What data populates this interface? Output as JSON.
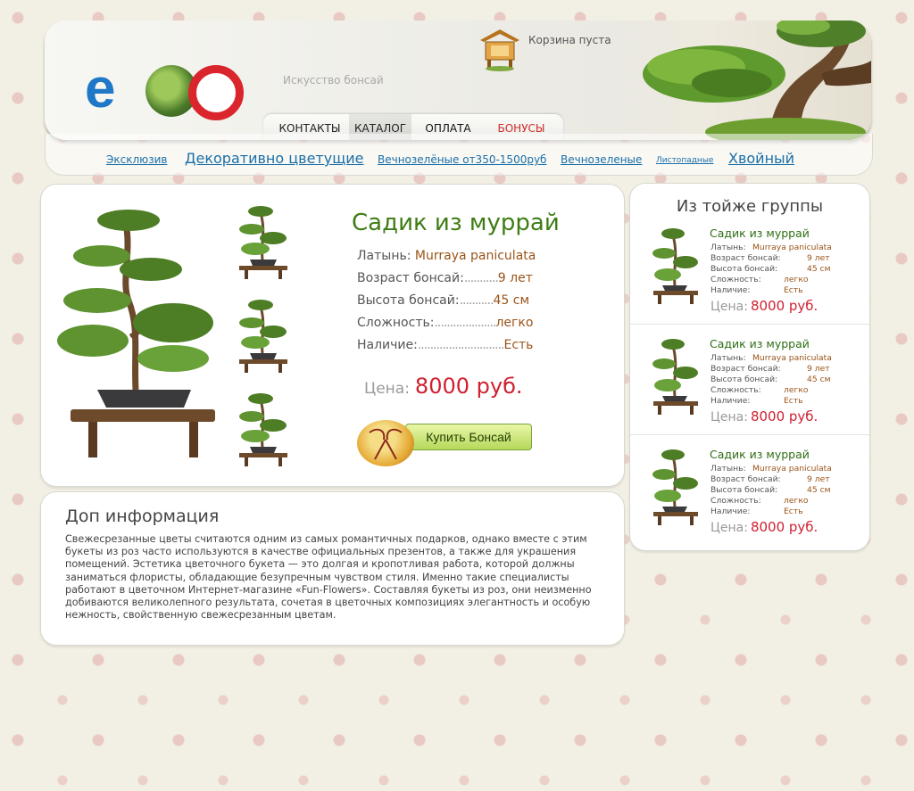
{
  "header": {
    "tagline": "Искусство бонсай",
    "cart_text": "Корзина пуста",
    "nav": [
      {
        "label": "КОНТАКТЫ"
      },
      {
        "label": "КАТАЛОГ"
      },
      {
        "label": "ОПЛАТА"
      },
      {
        "label": "БОНУСЫ"
      }
    ]
  },
  "subnav": [
    {
      "label": "Эксклюзив"
    },
    {
      "label": "Декоративно цветущие"
    },
    {
      "label": "Вечнозелёные от350-1500руб"
    },
    {
      "label": "Вечнозеленые"
    },
    {
      "label": "Листопадные"
    },
    {
      "label": "Хвойный"
    }
  ],
  "product": {
    "title": "Садик из муррай",
    "specs": [
      {
        "label": "Латынь:",
        "dots": "",
        "value": "Murraya paniculata"
      },
      {
        "label": "Возраст бонсай:",
        "dots": "...........",
        "value": "9 лет"
      },
      {
        "label": "Высота бонсай:",
        "dots": "...........",
        "value": "45 см"
      },
      {
        "label": "Сложность:",
        "dots": "....................",
        "value": "легко"
      },
      {
        "label": "Наличие:",
        "dots": "............................",
        "value": "Есть"
      }
    ],
    "price_label": "Цена:",
    "price_value": "8000 руб.",
    "buy_label": "Купить Бонсай"
  },
  "info": {
    "title": "Доп информация",
    "text": "Свежесрезанные цветы считаются одним из самых романтичных подарков, однако вместе с этим букеты из роз часто используются в качестве официальных презентов, а также для украшения помещений. Эстетика цветочного букета — это долгая и кропотливая работа, которой должны заниматься флористы, обладающие безупречным чувством стиля. Именно такие специалисты работают в цветочном Интернет-магазине «Fun-Flowers». Составляя букеты из роз, они неизменно добиваются великолепного результата, сочетая в цветочных композициях элегантность и особую нежность, свойственную свежесрезанным цветам."
  },
  "related": {
    "title": "Из тойже группы",
    "items": [
      {
        "name": "Садик из муррай",
        "specs": [
          {
            "label": "Латынь:",
            "value": "Murraya paniculata"
          },
          {
            "label": "Возраст бонсай:",
            "value": "9 лет"
          },
          {
            "label": "Высота бонсай:",
            "value": "45 см"
          },
          {
            "label": "Сложность:",
            "value": "легко"
          },
          {
            "label": "Наличие:",
            "value": "Есть"
          }
        ],
        "price_label": "Цена:",
        "price_value": "8000 руб."
      },
      {
        "name": "Садик из муррай",
        "specs": [
          {
            "label": "Латынь:",
            "value": "Murraya paniculata"
          },
          {
            "label": "Возраст бонсай:",
            "value": "9 лет"
          },
          {
            "label": "Высота бонсай:",
            "value": "45 см"
          },
          {
            "label": "Сложность:",
            "value": "легко"
          },
          {
            "label": "Наличие:",
            "value": "Есть"
          }
        ],
        "price_label": "Цена:",
        "price_value": "8000 руб."
      },
      {
        "name": "Садик из муррай",
        "specs": [
          {
            "label": "Латынь:",
            "value": "Murraya paniculata"
          },
          {
            "label": "Возраст бонсай:",
            "value": "9 лет"
          },
          {
            "label": "Высота бонсай:",
            "value": "45 см"
          },
          {
            "label": "Сложность:",
            "value": "легко"
          },
          {
            "label": "Наличие:",
            "value": "Есть"
          }
        ],
        "price_label": "Цена:",
        "price_value": "8000 руб."
      }
    ]
  },
  "colors": {
    "accent_green": "#3f7d14",
    "price_red": "#cf2030",
    "link_blue": "#1b6fa8",
    "bonus_red": "#cf2a2a",
    "spec_value_brown": "#9b5418"
  },
  "icons": [
    "logo",
    "cart-icon",
    "bonsai-tree-icon",
    "gift-box-icon"
  ]
}
